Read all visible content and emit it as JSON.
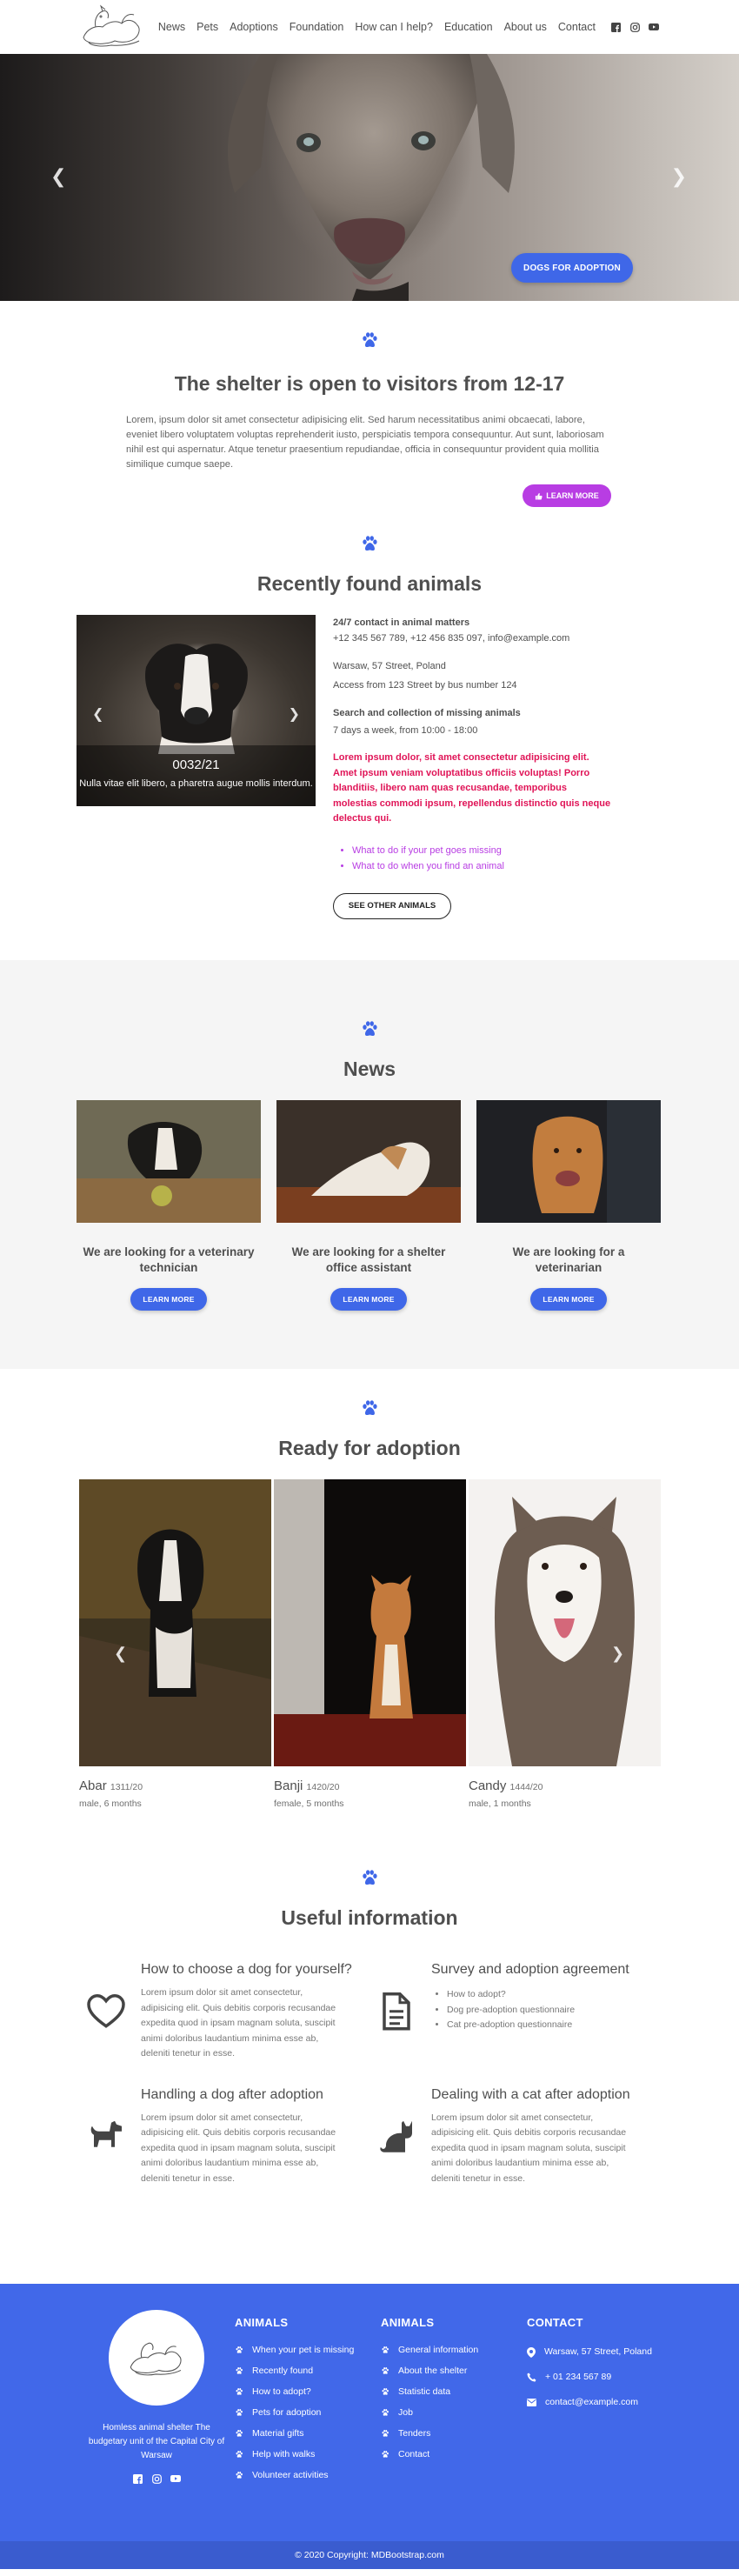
{
  "nav": {
    "links": [
      "News",
      "Pets",
      "Adoptions",
      "Foundation",
      "How can I help?",
      "Education",
      "About us",
      "Contact"
    ]
  },
  "hero": {
    "button": "DOGS FOR ADOPTION"
  },
  "shelter": {
    "title": "The shelter is open to visitors from 12-17",
    "text": "Lorem, ipsum dolor sit amet consectetur adipisicing elit. Sed harum necessitatibus animi obcaecati, labore, eveniet libero voluptatem voluptas reprehenderit iusto, perspiciatis tempora consequuntur. Aut sunt, laboriosam nihil est qui aspernatur. Atque tenetur praesentium repudiandae, officia in consequuntur provident quia mollitia similique cumque saepe.",
    "button": "LEARN MORE"
  },
  "recent": {
    "title": "Recently found animals",
    "caption_number": "0032/21",
    "caption_text": "Nulla vitae elit libero, a pharetra augue mollis interdum.",
    "contact_heading": "24/7 contact in animal matters",
    "contact_line": "+12 345 567 789, +12 456 835 097, info@example.com",
    "address": "Warsaw, 57 Street, Poland",
    "access": "Access from 123 Street by bus number 124",
    "search_heading": "Search and collection of missing animals",
    "search_hours": "7 days a week, from 10:00 - 18:00",
    "red_text": "Lorem ipsum dolor, sit amet consectetur adipisicing elit. Amet ipsum veniam voluptatibus officiis voluptas! Porro blanditiis, libero nam quas recusandae, temporibus molestias commodi ipsum, repellendus distinctio quis neque delectus qui.",
    "links": [
      "What to do if your pet goes missing",
      "What to do when you find an animal"
    ],
    "button": "SEE OTHER ANIMALS"
  },
  "news": {
    "title": "News",
    "items": [
      {
        "title": "We are looking for a veterinary technician",
        "button": "LEARN MORE"
      },
      {
        "title": "We are looking for a shelter office assistant",
        "button": "LEARN MORE"
      },
      {
        "title": "We are looking for a veterinarian",
        "button": "LEARN MORE"
      }
    ]
  },
  "adoption": {
    "title": "Ready for adoption",
    "pets": [
      {
        "name": "Abar",
        "id": "1311/20",
        "details": "male, 6 months"
      },
      {
        "name": "Banji",
        "id": "1420/20",
        "details": "female, 5 months"
      },
      {
        "name": "Candy",
        "id": "1444/20",
        "details": "male, 1 months"
      }
    ]
  },
  "useful": {
    "title": "Useful information",
    "items": [
      {
        "title": "How to choose a dog for yourself?",
        "text": "Lorem ipsum dolor sit amet consectetur, adipisicing elit. Quis debitis corporis recusandae expedita quod in ipsam magnam soluta, suscipit animi doloribus laudantium minima esse ab, deleniti tenetur in esse."
      },
      {
        "title": "Survey and adoption agreement",
        "list": [
          "How to adopt?",
          "Dog pre-adoption questionnaire",
          "Cat pre-adoption questionnaire"
        ]
      },
      {
        "title": "Handling a dog after adoption",
        "text": "Lorem ipsum dolor sit amet consectetur, adipisicing elit. Quis debitis corporis recusandae expedita quod in ipsam magnam soluta, suscipit animi doloribus laudantium minima esse ab, deleniti tenetur in esse."
      },
      {
        "title": "Dealing with a cat after adoption",
        "text": "Lorem ipsum dolor sit amet consectetur, adipisicing elit. Quis debitis corporis recusandae expedita quod in ipsam magnam soluta, suscipit animi doloribus laudantium minima esse ab, deleniti tenetur in esse."
      }
    ]
  },
  "footer": {
    "brand_text": "Homless animal shelter The budgetary unit of the Capital City of Warsaw",
    "col1": {
      "title": "ANIMALS",
      "items": [
        "When your pet is missing",
        "Recently found",
        "How to adopt?",
        "Pets for adoption",
        "Material gifts",
        "Help with walks",
        "Volunteer activities"
      ]
    },
    "col2": {
      "title": "ANIMALS",
      "items": [
        "General information",
        "About the shelter",
        "Statistic data",
        "Job",
        "Tenders",
        "Contact"
      ]
    },
    "col3": {
      "title": "CONTACT",
      "address": "Warsaw, 57 Street, Poland",
      "phone": "+ 01 234 567 89",
      "email": "contact@example.com"
    },
    "copyright": "© 2020 Copyright: MDBootstrap.com"
  },
  "colors": {
    "primary": "#3f67e8",
    "purple": "#b83de3",
    "red": "#e01457",
    "footer": "#4168e9"
  }
}
